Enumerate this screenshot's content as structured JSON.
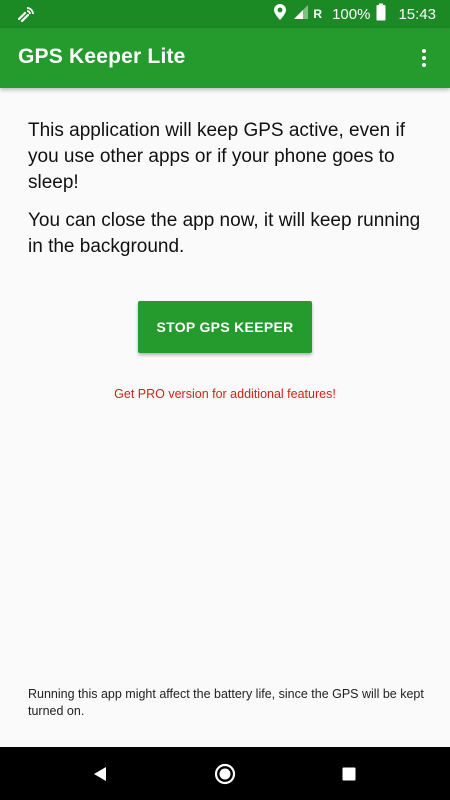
{
  "status_bar": {
    "network_label": "R",
    "battery": "100%",
    "time": "15:43"
  },
  "app_bar": {
    "title": "GPS Keeper Lite"
  },
  "main": {
    "intro_text": "This application will keep GPS active, even if you use other apps or if your phone goes to sleep!",
    "background_text": "You can close the app now, it will keep running in the background.",
    "stop_button_label": "STOP GPS KEEPER",
    "pro_link_text": "Get PRO version for additional features!",
    "battery_note": "Running this app might affect the battery life, since the GPS will be kept turned on."
  },
  "icons": {
    "status_left": "gps-keeper-notification-icon",
    "location": "location-pin-icon",
    "signal": "signal-icon",
    "battery": "battery-icon",
    "overflow": "more-vert-icon",
    "nav_back": "back-icon",
    "nav_home": "home-icon",
    "nav_recents": "recents-icon"
  },
  "colors": {
    "status_bar": "#1b8a24",
    "app_bar": "#259b2e",
    "button": "#259b2e",
    "pro_link": "#d3201a",
    "background": "#fafafa"
  }
}
